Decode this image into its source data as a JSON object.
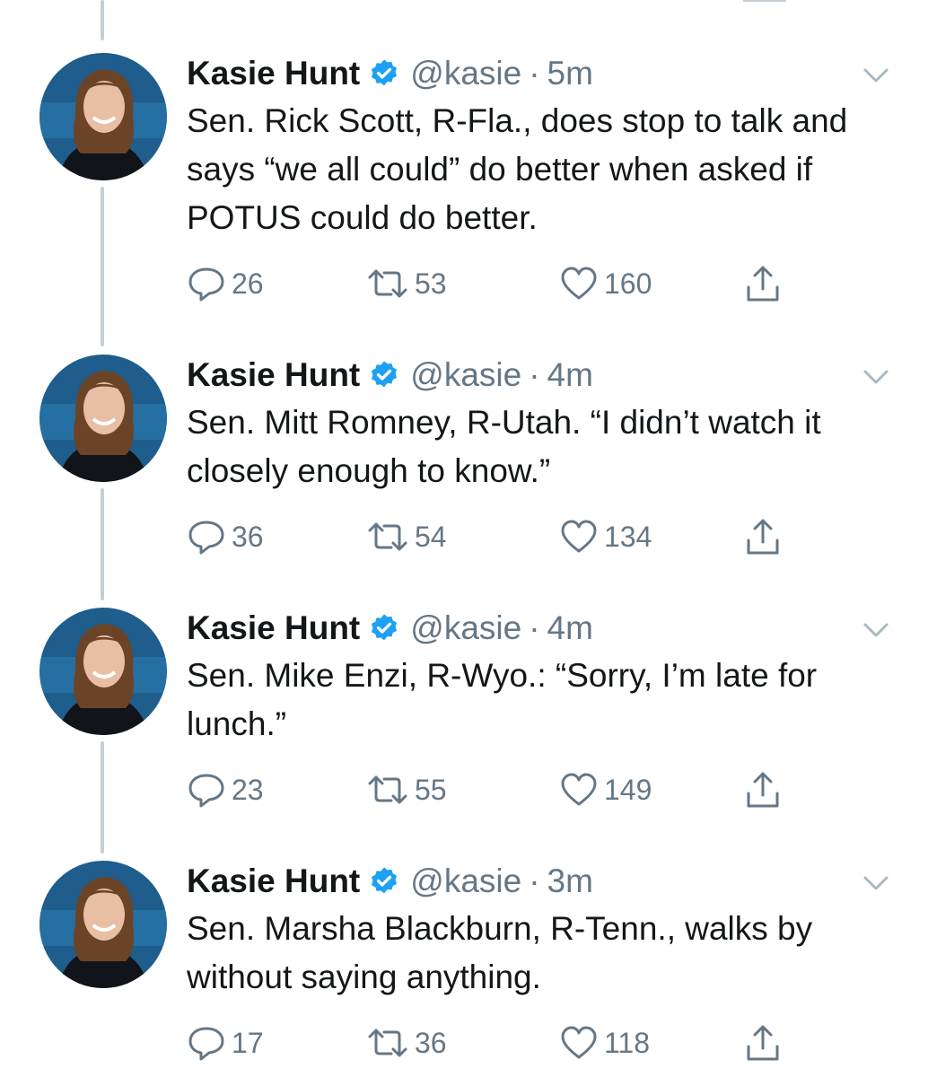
{
  "colors": {
    "accent": "#1da1f2",
    "text": "#14171a",
    "secondary": "#657786",
    "thread_line": "#c4cfd6"
  },
  "icons": {
    "verified": "verified-badge-icon",
    "chevron": "chevron-down-icon",
    "reply": "reply-icon",
    "retweet": "retweet-icon",
    "like": "heart-icon",
    "share": "share-icon"
  },
  "tweets": [
    {
      "name": "Kasie Hunt",
      "handle": "@kasie",
      "separator": "·",
      "time": "5m",
      "text": "Sen. Rick Scott, R-Fla., does stop to talk and says “we all could” do better when asked if POTUS could do better.",
      "replies": "26",
      "retweets": "53",
      "likes": "160"
    },
    {
      "name": "Kasie Hunt",
      "handle": "@kasie",
      "separator": "·",
      "time": "4m",
      "text": "Sen. Mitt Romney, R-Utah. “I didn’t watch it closely enough to know.”",
      "replies": "36",
      "retweets": "54",
      "likes": "134"
    },
    {
      "name": "Kasie Hunt",
      "handle": "@kasie",
      "separator": "·",
      "time": "4m",
      "text": "Sen. Mike Enzi, R-Wyo.: “Sorry, I’m late for lunch.”",
      "replies": "23",
      "retweets": "55",
      "likes": "149"
    },
    {
      "name": "Kasie Hunt",
      "handle": "@kasie",
      "separator": "·",
      "time": "3m",
      "text": "Sen. Marsha Blackburn, R-Tenn., walks by without saying anything.",
      "replies": "17",
      "retweets": "36",
      "likes": "118"
    }
  ]
}
